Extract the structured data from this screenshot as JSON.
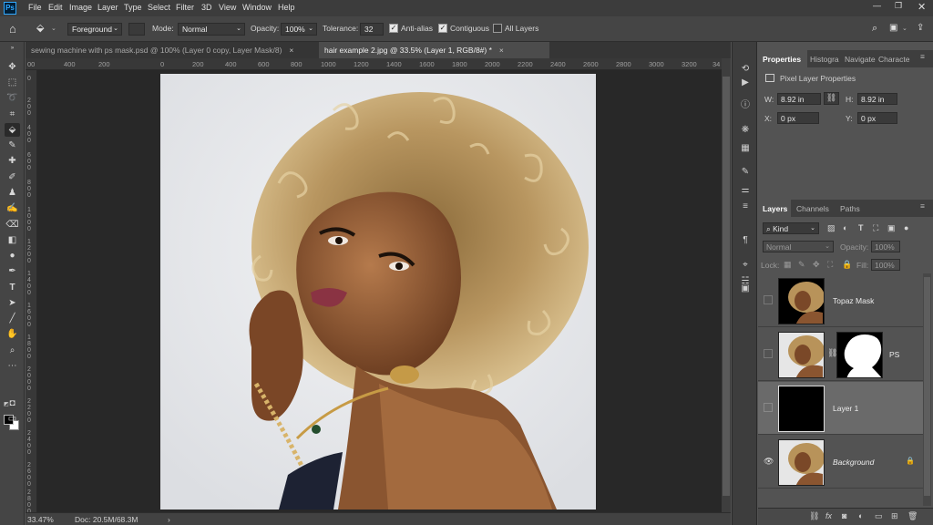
{
  "app": {
    "logo": "Ps"
  },
  "menu": [
    "File",
    "Edit",
    "Image",
    "Layer",
    "Type",
    "Select",
    "Filter",
    "3D",
    "View",
    "Window",
    "Help"
  ],
  "options": {
    "fill_source": "Foreground",
    "mode_label": "Mode:",
    "mode_value": "Normal",
    "opacity_label": "Opacity:",
    "opacity_value": "100%",
    "tolerance_label": "Tolerance:",
    "tolerance_value": "32",
    "antialias_label": "Anti-alias",
    "antialias_checked": true,
    "contiguous_label": "Contiguous",
    "contiguous_checked": true,
    "alllayers_label": "All Layers",
    "alllayers_checked": false
  },
  "tabs": [
    {
      "label": "sewing machine with ps mask.psd @ 100% (Layer 0 copy, Layer Mask/8)",
      "close": "×",
      "active": false
    },
    {
      "label": "hair example 2.jpg @ 33.5% (Layer 1, RGB/8#) *",
      "close": "×",
      "active": true
    }
  ],
  "ruler_h": [
    "00",
    "400",
    "200",
    "0",
    "200",
    "400",
    "600",
    "800",
    "1000",
    "1200",
    "1400",
    "1600",
    "1800",
    "2000",
    "2200",
    "2400",
    "2600",
    "2800",
    "3000",
    "3200",
    "34"
  ],
  "ruler_v": [
    "0",
    "2 0 0",
    "4 0 0",
    "6 0 0",
    "8 0 0",
    "1 0 0 0",
    "1 2 0 0",
    "1 4 0 0",
    "1 6 0 0",
    "1 8 0 0",
    "2 0 0 0",
    "2 2 0 0",
    "2 4 0 0",
    "2 6 0 0",
    "2 8 0 0",
    "3 0 0 0"
  ],
  "status": {
    "zoom": "33.47%",
    "doc": "Doc: 20.5M/68.3M"
  },
  "properties": {
    "tabs": [
      "Properties",
      "Histogra",
      "Navigate",
      "Characte"
    ],
    "section": "Pixel Layer Properties",
    "w_label": "W:",
    "w_value": "8.92 in",
    "h_label": "H:",
    "h_value": "8.92 in",
    "x_label": "X:",
    "x_value": "0 px",
    "y_label": "Y:",
    "y_value": "0 px"
  },
  "layers_panel": {
    "tabs": [
      "Layers",
      "Channels",
      "Paths"
    ],
    "filter_kind": "Kind",
    "blend_mode": "Normal",
    "opacity_label": "Opacity:",
    "opacity_value": "100%",
    "lock_label": "Lock:",
    "fill_label": "Fill:",
    "fill_value": "100%",
    "layers": [
      {
        "name": "Topaz Mask",
        "visible": false,
        "selected": false,
        "has_mask": false,
        "locked": false
      },
      {
        "name": "PS",
        "visible": false,
        "selected": false,
        "has_mask": true,
        "locked": false
      },
      {
        "name": "Layer 1",
        "visible": false,
        "selected": true,
        "has_mask": false,
        "locked": false
      },
      {
        "name": "Background",
        "visible": true,
        "selected": false,
        "has_mask": false,
        "locked": true
      }
    ]
  },
  "colors": {
    "accent": "#31a8ff",
    "panel_bg": "#535353",
    "canvas_bg": "#282828"
  }
}
